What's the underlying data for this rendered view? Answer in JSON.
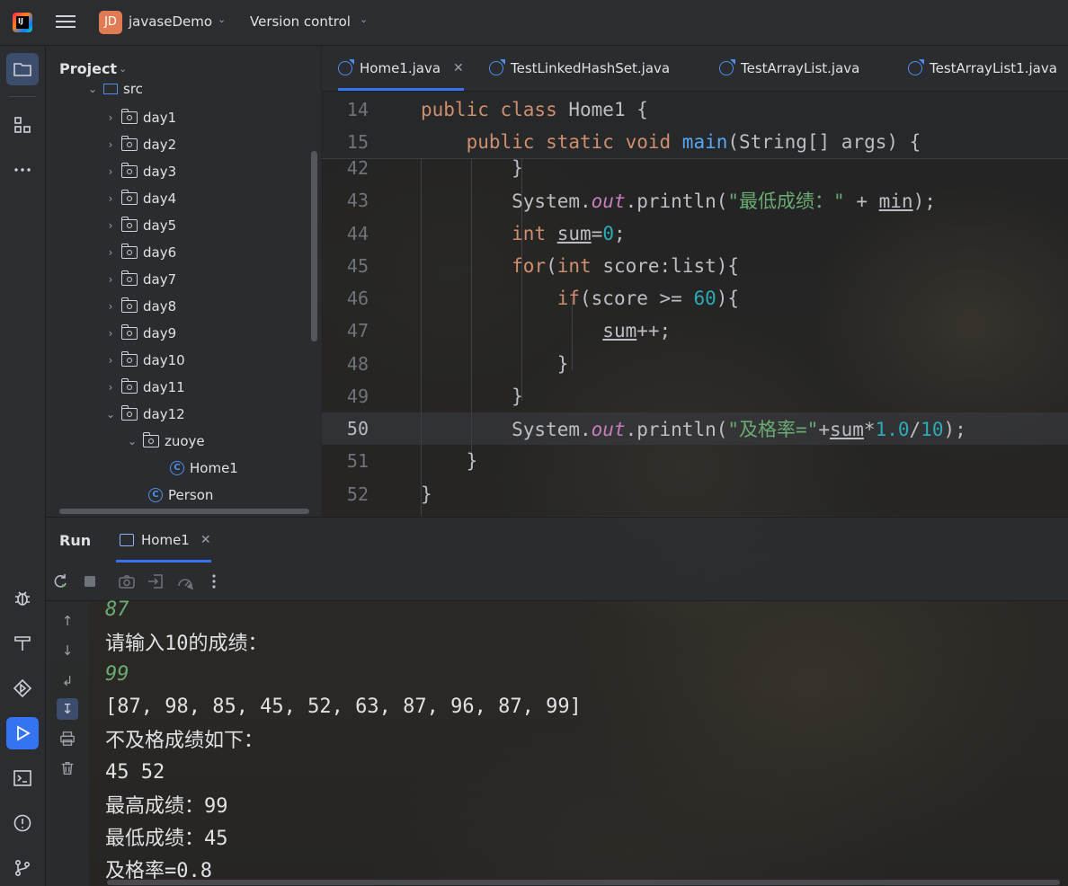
{
  "titlebar": {
    "project_badge": "JD",
    "project_name": "javaseDemo",
    "vcs_label": "Version control"
  },
  "left_toolbar": {
    "items": [
      "project-icon",
      "structure-icon",
      "more-icon",
      "debug-icon",
      "build-icon",
      "services-icon",
      "run-icon",
      "terminal-icon",
      "problems-icon",
      "git-icon"
    ]
  },
  "project_panel": {
    "title": "Project",
    "src_label": "src",
    "tree": [
      {
        "label": "day1"
      },
      {
        "label": "day2"
      },
      {
        "label": "day3"
      },
      {
        "label": "day4"
      },
      {
        "label": "day5"
      },
      {
        "label": "day6"
      },
      {
        "label": "day7"
      },
      {
        "label": "day8"
      },
      {
        "label": "day9"
      },
      {
        "label": "day10"
      },
      {
        "label": "day11"
      },
      {
        "label": "day12"
      }
    ],
    "subfolder": "zuoye",
    "class_home": "Home1",
    "class_person": "Person"
  },
  "editor_tabs": [
    {
      "label": "Home1.java",
      "active": true
    },
    {
      "label": "TestLinkedHashSet.java",
      "active": false
    },
    {
      "label": "TestArrayList.java",
      "active": false
    },
    {
      "label": "TestArrayList1.java",
      "active": false
    }
  ],
  "editor": {
    "sticky_lines": [
      {
        "num": "14",
        "text": "public class Home1 {"
      },
      {
        "num": "15",
        "text": "    public static void main(String[] args) {"
      }
    ],
    "lines": [
      {
        "num": "42",
        "text": "        }"
      },
      {
        "num": "43",
        "text": "        System.out.println(\"最低成绩：\" + min);"
      },
      {
        "num": "44",
        "text": "        int sum=0;"
      },
      {
        "num": "45",
        "text": "        for(int score:list){"
      },
      {
        "num": "46",
        "text": "            if(score >= 60){"
      },
      {
        "num": "47",
        "text": "                sum++;"
      },
      {
        "num": "48",
        "text": "            }"
      },
      {
        "num": "49",
        "text": "        }"
      },
      {
        "num": "50",
        "text": "        System.out.println(\"及格率=\"+sum*1.0/10);"
      },
      {
        "num": "51",
        "text": "    }"
      },
      {
        "num": "52",
        "text": "}"
      }
    ],
    "current_line": "50"
  },
  "run_panel": {
    "title": "Run",
    "tab_label": "Home1",
    "console": [
      {
        "text": "87",
        "type": "input"
      },
      {
        "text": "请输入10的成绩：",
        "type": "output"
      },
      {
        "text": "99",
        "type": "input"
      },
      {
        "text": "[87, 98, 85, 45, 52, 63, 87, 96, 87, 99]",
        "type": "output"
      },
      {
        "text": "不及格成绩如下：",
        "type": "output"
      },
      {
        "text": "45 52",
        "type": "output"
      },
      {
        "text": "最高成绩：99",
        "type": "output"
      },
      {
        "text": "最低成绩：45",
        "type": "output"
      },
      {
        "text": "及格率=0.8",
        "type": "output"
      }
    ]
  },
  "colors": {
    "accent": "#3574f0",
    "keyword": "#cf8e6d",
    "string": "#6aab73",
    "number": "#2aacb8",
    "static_field": "#c77dbb",
    "method": "#56a8f5"
  }
}
